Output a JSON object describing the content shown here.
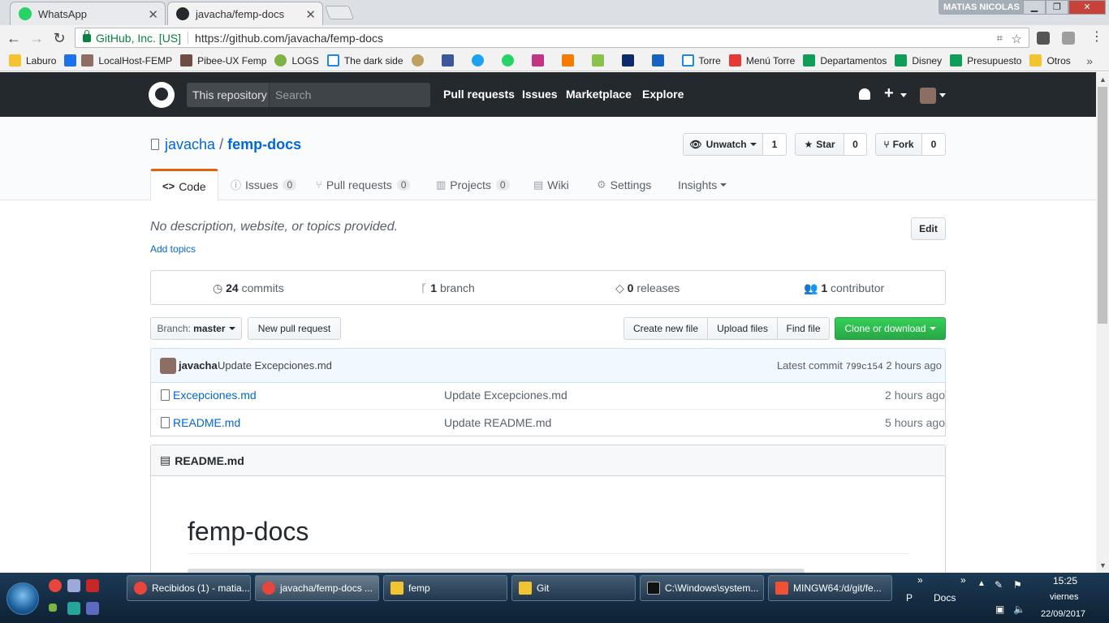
{
  "browser": {
    "tabs": [
      {
        "title": "WhatsApp",
        "active": false
      },
      {
        "title": "javacha/femp-docs",
        "active": true
      }
    ],
    "user_badge": "MATIAS NICOLAS",
    "secure_label": "GitHub, Inc. [US]",
    "url": "https://github.com/javacha/femp-docs",
    "bookmarks": [
      "Laburo",
      "LocalHost-FEMP",
      "Pibee-UX Femp",
      "LOGS",
      "The dark side",
      "Torre",
      "Menú Torre",
      "Departamentos",
      "Disney",
      "Presupuesto",
      "Otros"
    ]
  },
  "header": {
    "scope": "This repository",
    "search_placeholder": "Search",
    "nav": [
      "Pull requests",
      "Issues",
      "Marketplace",
      "Explore"
    ]
  },
  "repo": {
    "owner": "javacha",
    "separator": "/",
    "name": "femp-docs",
    "watch_label": "Unwatch",
    "watch_count": "1",
    "star_label": "Star",
    "star_count": "0",
    "fork_label": "Fork",
    "fork_count": "0",
    "tabs": [
      {
        "label": "Code",
        "count": null
      },
      {
        "label": "Issues",
        "count": "0"
      },
      {
        "label": "Pull requests",
        "count": "0"
      },
      {
        "label": "Projects",
        "count": "0"
      },
      {
        "label": "Wiki",
        "count": null
      },
      {
        "label": "Settings",
        "count": null
      },
      {
        "label": "Insights",
        "count": null
      }
    ],
    "description": "No description, website, or topics provided.",
    "add_topics": "Add topics",
    "edit_label": "Edit",
    "summary": {
      "commits_num": "24",
      "commits_label": "commits",
      "branch_num": "1",
      "branch_label": "branch",
      "releases_num": "0",
      "releases_label": "releases",
      "contributor_num": "1",
      "contributor_label": "contributor"
    },
    "branch_prefix": "Branch:",
    "branch": "master",
    "new_pr": "New pull request",
    "create_file": "Create new file",
    "upload_files": "Upload files",
    "find_file": "Find file",
    "clone": "Clone or download",
    "latest_commit": {
      "author": "javacha",
      "message": "Update Excepciones.md",
      "label": "Latest commit",
      "sha": "799c154",
      "age": "2 hours ago"
    },
    "files": [
      {
        "name": "Excepciones.md",
        "message": "Update Excepciones.md",
        "age": "2 hours ago"
      },
      {
        "name": "README.md",
        "message": "Update README.md",
        "age": "5 hours ago"
      }
    ],
    "readme_title": "README.md",
    "readme_h1": "femp-docs"
  },
  "taskbar": {
    "tasks": [
      "Recibidos (1) - matia...",
      "javacha/femp-docs ...",
      "femp",
      "Git",
      "C:\\Windows\\system...",
      "MINGW64:/d/git/fe..."
    ],
    "tray_p": "P",
    "tray_docs": "Docs",
    "time": "15:25",
    "day": "viernes",
    "date": "22/09/2017"
  },
  "colors": {
    "accent": "#0366d6",
    "header_bg": "#24292e",
    "clone_green": "#28a745",
    "tab_orange": "#e36209"
  }
}
